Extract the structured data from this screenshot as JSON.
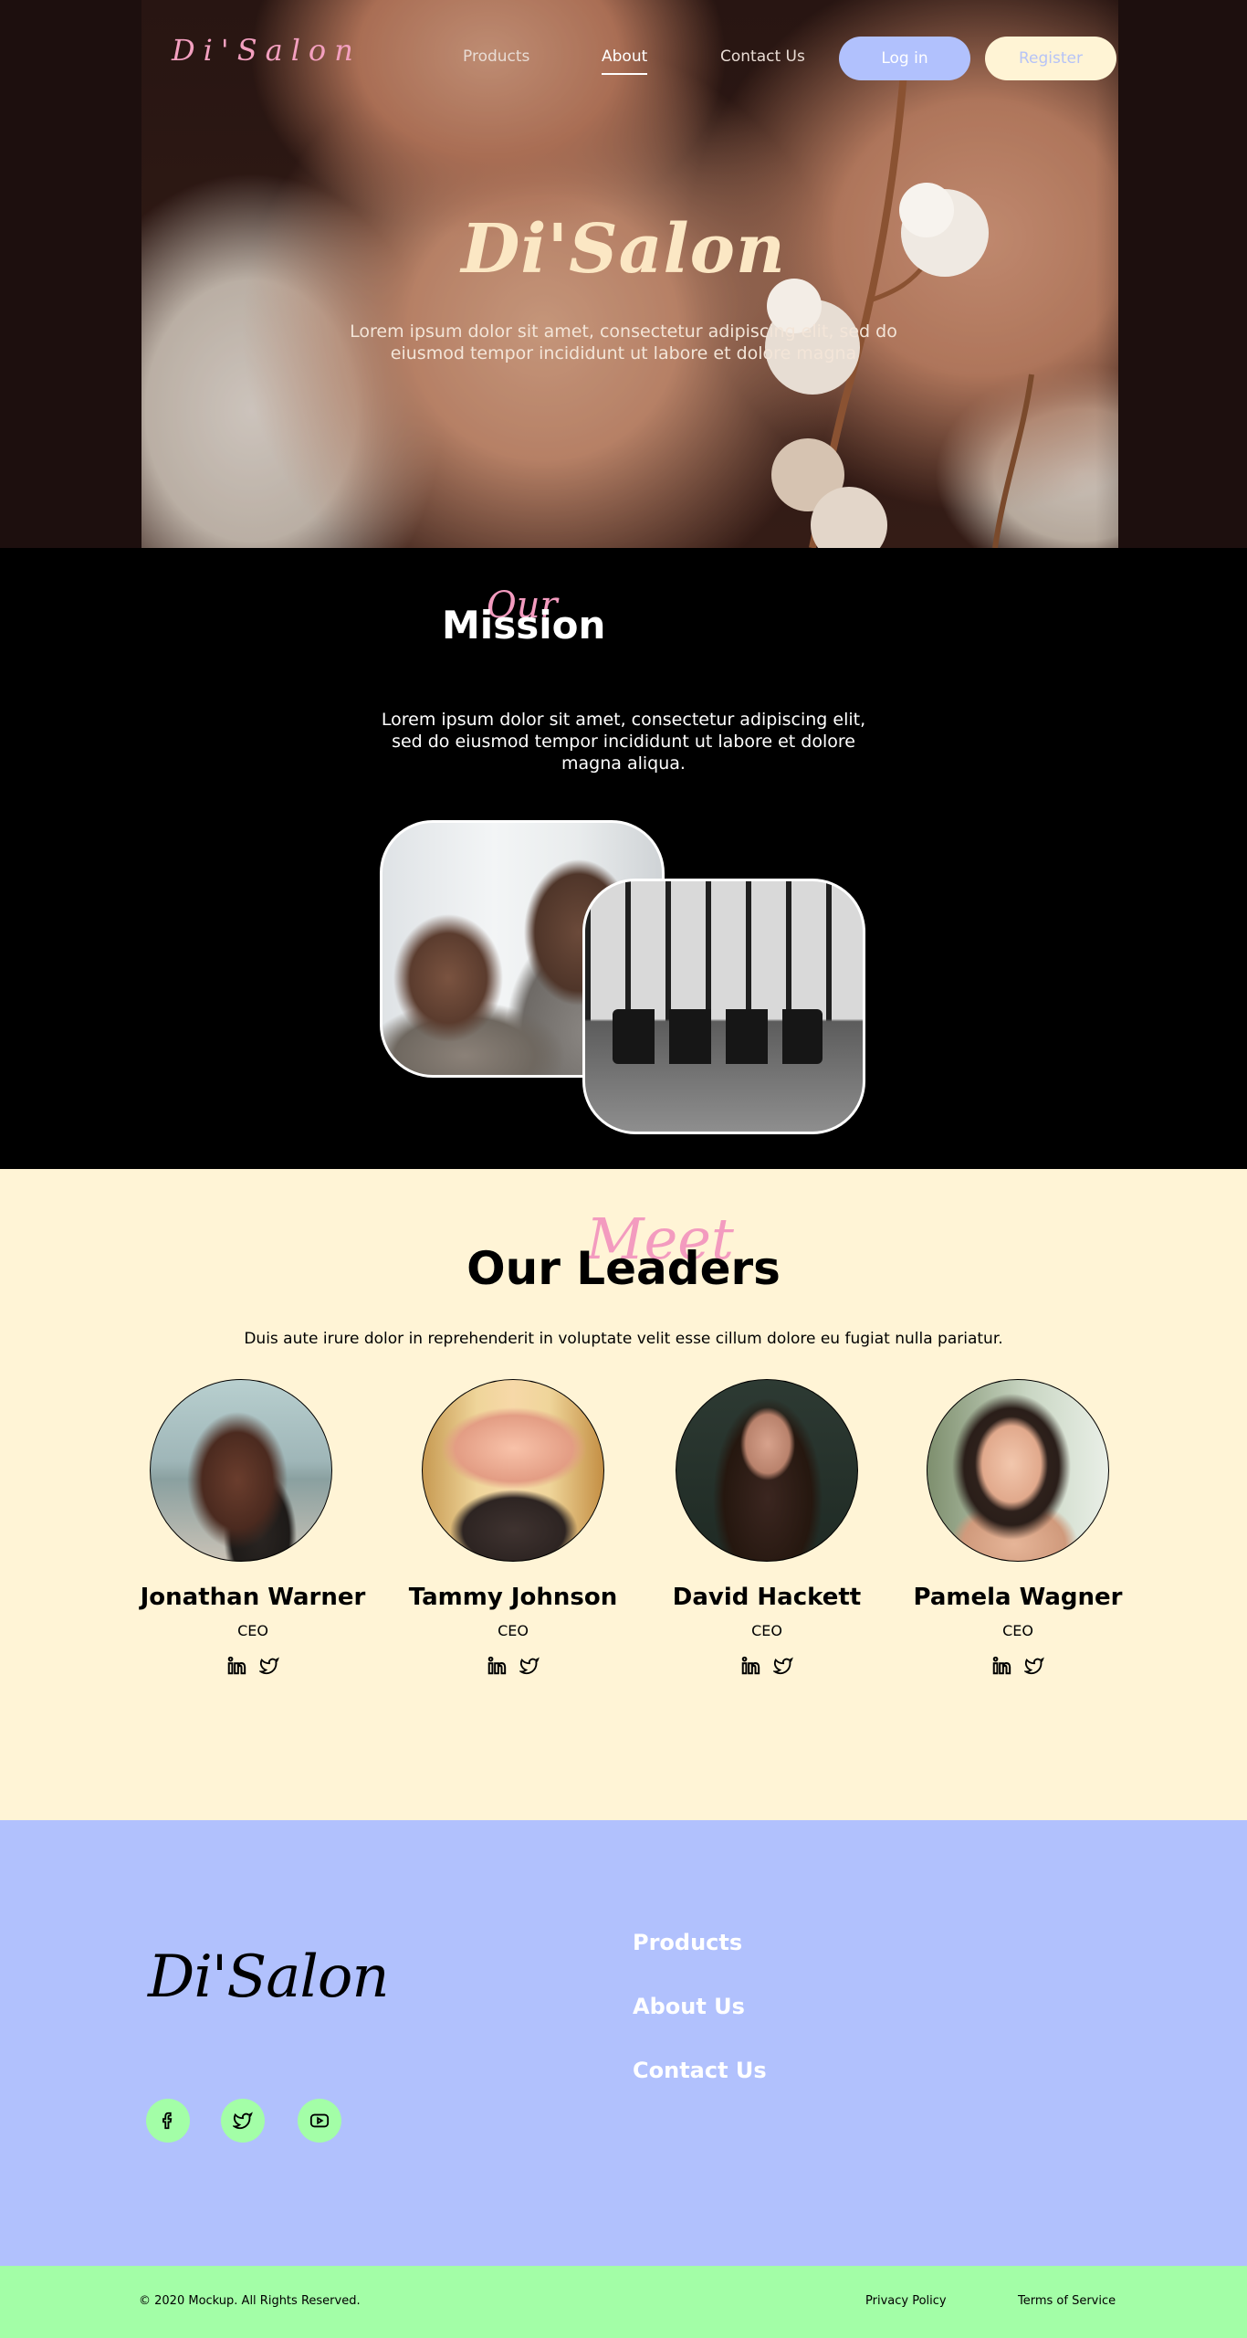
{
  "nav": {
    "logo": "Di'Salon",
    "links": [
      "Products",
      "About",
      "Contact Us"
    ],
    "active": "About",
    "login": "Log in",
    "register": "Register"
  },
  "hero": {
    "title": "Di'Salon",
    "subtitle": "Lorem ipsum dolor sit amet, consectetur adipiscing elit, sed do eiusmod tempor incididunt ut labore et dolore magna"
  },
  "mission": {
    "script": "Our",
    "heading": "Mission",
    "text": "Lorem ipsum dolor sit amet, consectetur adipiscing elit, sed do eiusmod tempor incididunt ut labore et dolore magna aliqua."
  },
  "leaders": {
    "script": "Meet",
    "heading": "Our Leaders",
    "description": "Duis aute irure dolor in reprehenderit in voluptate velit esse cillum dolore eu fugiat nulla pariatur.",
    "people": [
      {
        "name": "Jonathan Warner",
        "role": "CEO"
      },
      {
        "name": "Tammy Johnson",
        "role": "CEO"
      },
      {
        "name": "David Hackett",
        "role": "CEO"
      },
      {
        "name": "Pamela Wagner",
        "role": "CEO"
      }
    ]
  },
  "footer": {
    "brand": "Di'Salon",
    "links": [
      "Products",
      "About Us",
      "Contact Us"
    ],
    "social_icons": [
      "facebook-icon",
      "twitter-icon",
      "youtube-icon"
    ],
    "copyright": "© 2020 Mockup.  All Rights Reserved.",
    "privacy": "Privacy Policy",
    "terms": "Terms of Service"
  },
  "colors": {
    "pink": "#f39bbf",
    "lavender": "#b1c1fd",
    "cream": "#fff4d6",
    "mint": "#a3fea7"
  }
}
